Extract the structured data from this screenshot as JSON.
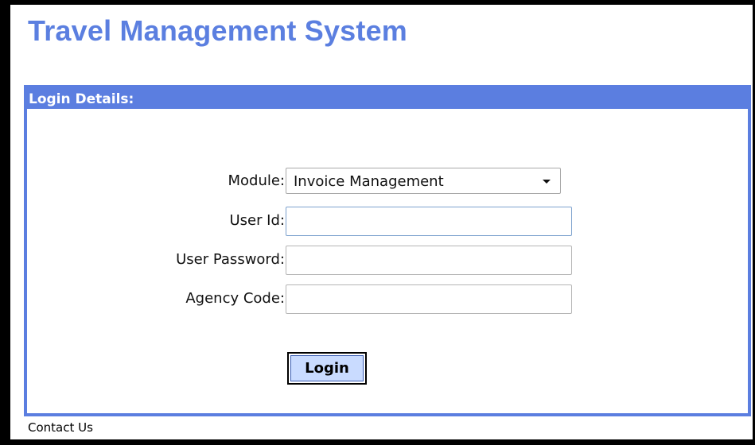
{
  "app": {
    "title": "Travel Management System"
  },
  "login_panel": {
    "title": "Login Details:",
    "module": {
      "label": "Module:",
      "selected": "Invoice Management"
    },
    "user_id": {
      "label": "User Id:",
      "value": ""
    },
    "user_password": {
      "label": "User Password:",
      "value": ""
    },
    "agency_code": {
      "label": "Agency Code:",
      "value": ""
    },
    "submit_label": "Login"
  },
  "footer": {
    "contact_label": "Contact Us"
  },
  "colors": {
    "accent": "#5b7ee0",
    "title_text": "#5b7fe0",
    "button_fill": "#c9dbff",
    "window_border": "#000000"
  },
  "icons": {
    "module_dropdown": "chevron-down-icon"
  }
}
